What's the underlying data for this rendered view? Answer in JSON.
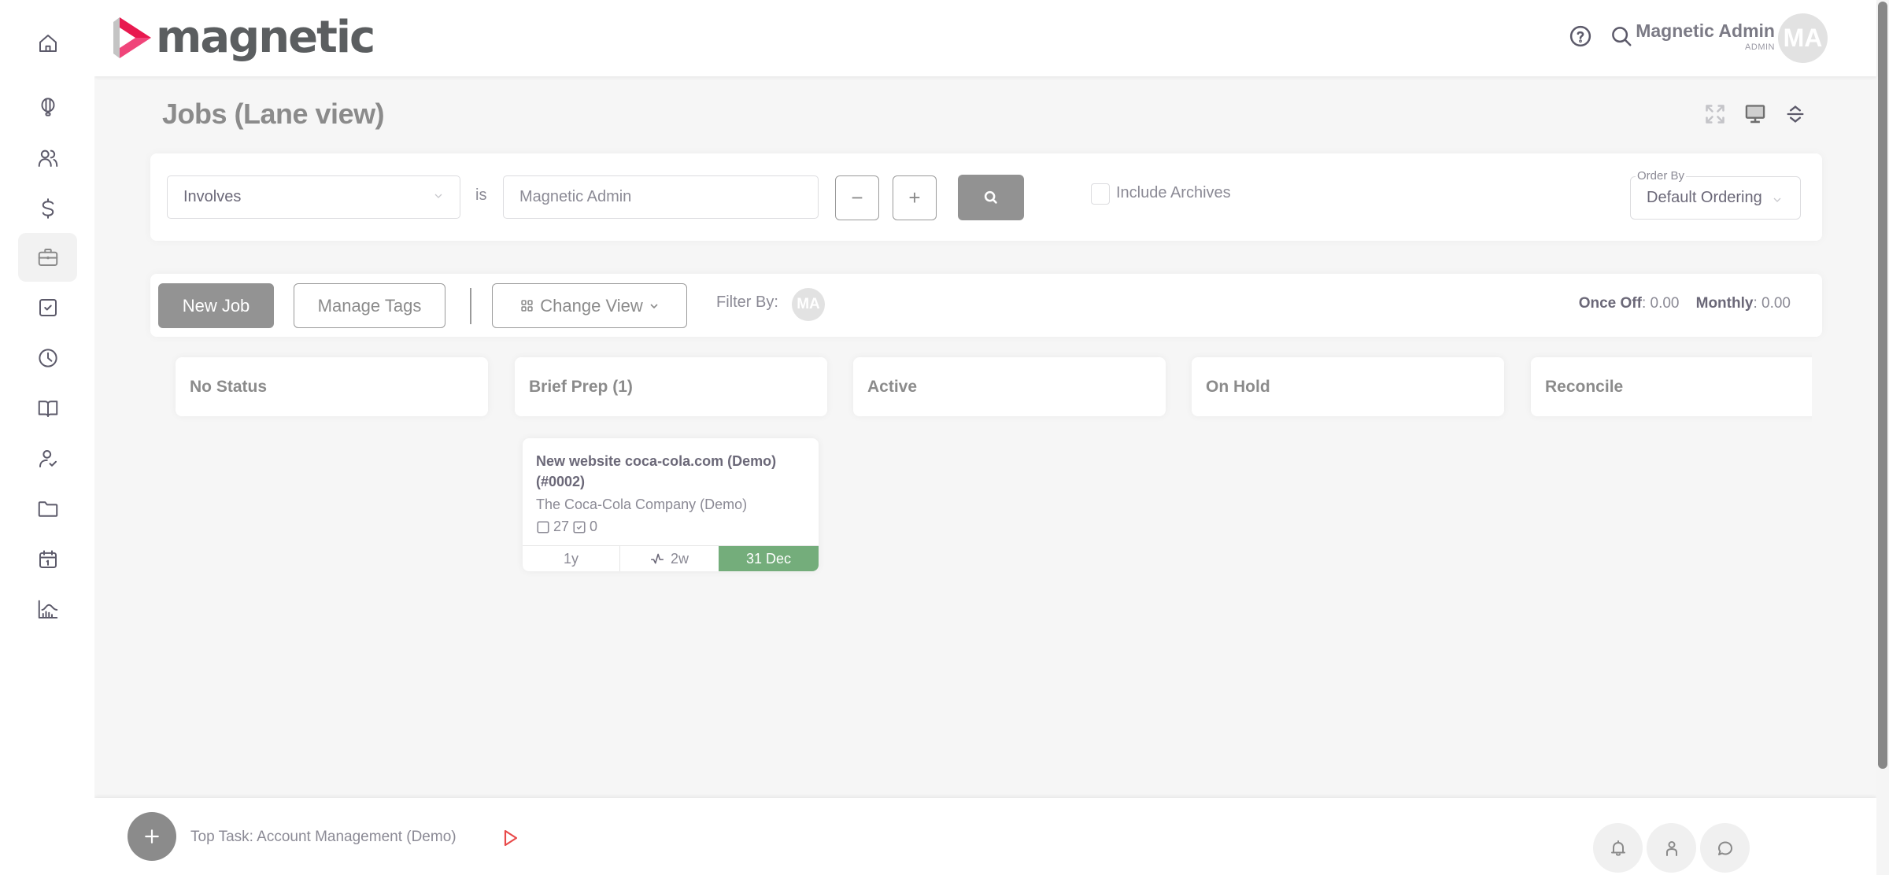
{
  "app": {
    "logo_text": "magnetic",
    "brand_colors": {
      "logo_red": "#e8194f",
      "logo_pink": "#f0457a",
      "logo_grey": "#c4c4c4"
    }
  },
  "sidebar": {
    "items": [
      {
        "icon": "home-icon",
        "label": "Home",
        "active": false
      },
      {
        "icon": "lightbulb-icon",
        "label": "Opportunities",
        "active": false
      },
      {
        "icon": "users-icon",
        "label": "Contacts",
        "active": false
      },
      {
        "icon": "dollar-icon",
        "label": "Finance",
        "active": false
      },
      {
        "icon": "briefcase-icon",
        "label": "Jobs",
        "active": true
      },
      {
        "icon": "checkbox-icon",
        "label": "Tasks",
        "active": false
      },
      {
        "icon": "clock-icon",
        "label": "Timesheets",
        "active": false
      },
      {
        "icon": "book-icon",
        "label": "Knowledge",
        "active": false
      },
      {
        "icon": "user-check-icon",
        "label": "Resources",
        "active": false
      },
      {
        "icon": "folder-icon",
        "label": "Files",
        "active": false
      },
      {
        "icon": "calendar-icon",
        "label": "Calendar",
        "active": false
      },
      {
        "icon": "chart-icon",
        "label": "Reports",
        "active": false
      }
    ]
  },
  "header": {
    "user_name": "Magnetic Admin",
    "user_role": "ADMIN",
    "avatar_initials": "MA"
  },
  "page": {
    "title": "Jobs (Lane view)"
  },
  "filter": {
    "field_value": "Involves",
    "operator_label": "is",
    "value_input": "Magnetic Admin",
    "minus_label": "−",
    "plus_label": "+",
    "include_archives_label": "Include Archives",
    "include_archives_checked": false,
    "order_by_label": "Order By",
    "order_by_value": "Default Ordering"
  },
  "toolbar": {
    "new_job_label": "New Job",
    "manage_tags_label": "Manage Tags",
    "change_view_label": "Change View",
    "filter_by_label": "Filter By:",
    "filter_avatar_initials": "MA",
    "once_off_label": "Once Off",
    "once_off_value": ": 0.00",
    "monthly_label": "Monthly",
    "monthly_value": ": 0.00"
  },
  "lanes": [
    {
      "title": "No Status"
    },
    {
      "title": "Brief Prep (1)"
    },
    {
      "title": "Active"
    },
    {
      "title": "On Hold"
    },
    {
      "title": "Reconcile"
    }
  ],
  "jobs": [
    {
      "lane": "Brief Prep",
      "title": "New website coca-cola.com (Demo) (#0002)",
      "client": "The Coca-Cola Company (Demo)",
      "open_tasks": "27",
      "done_tasks": "0",
      "age": "1y",
      "activity": "2w",
      "due": "31 Dec",
      "due_color": "#74ad7b"
    }
  ],
  "bottom": {
    "top_task": "Top Task: Account Management (Demo)"
  },
  "scrollbar": {
    "visible_fraction": 0.88,
    "position": 0
  }
}
